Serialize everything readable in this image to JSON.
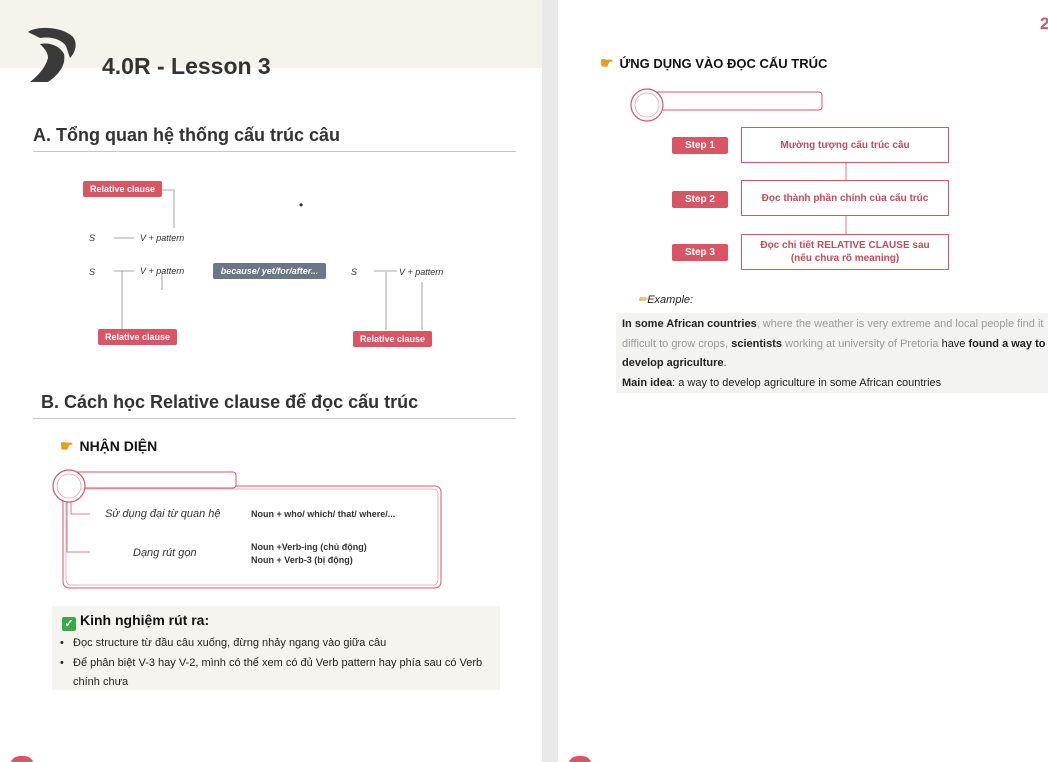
{
  "lesson_title": "4.0R - Lesson 3",
  "section_a": "A. Tổng quan hệ thống cấu trúc câu",
  "section_b": "B. Cách học Relative clause để đọc cấu trúc",
  "diagram": {
    "relative_clause": "Relative clause",
    "s": "S",
    "v_pattern": "V + pattern",
    "connectors": "because/ yet/for/after...",
    "dot": "•"
  },
  "nhan_dien": {
    "heading": "NHẬN DIỆN",
    "row1_label": "Sử dụng đại từ quan hệ",
    "row1_value": "Noun + who/ which/ that/ where/...",
    "row2_label": "Dạng rút gọn",
    "row2_value_1": "Noun +Verb-ing (chủ động)",
    "row2_value_2": "Noun + Verb-3 (bị động)"
  },
  "kinh_nghiem": {
    "title": "Kinh nghiệm rút ra:",
    "bullet_1": "Đọc structure từ đầu câu xuống, đừng nhảy ngang vào giữa câu",
    "bullet_2a": "Để phân biệt V-3 hay V-2, mình có thể xem có đủ Verb pattern hay phía sau có Verb",
    "bullet_2b": "chính chưa"
  },
  "ung_dung": {
    "heading": "ỨNG DỤNG VÀO ĐỌC CẤU TRÚC",
    "steps": [
      {
        "label": "Step 1",
        "text": "Mường tượng cấu trúc câu"
      },
      {
        "label": "Step 2",
        "text": "Đọc thành phần chính của cấu trúc"
      },
      {
        "label": "Step 3",
        "text": "Đọc chi tiết RELATIVE CLAUSE sau",
        "text2": "(nếu chưa rõ meaning)"
      }
    ],
    "example_label": "Example:",
    "ex": {
      "p1_bold": "In some African countries",
      "p1_grey": ", where the weather is very extreme and local people find it",
      "p2_grey": "difficult to grow crops,",
      "p2_bold": " scientists",
      "p2_grey2": " working at university of Pretoria",
      "p2_tail": " have ",
      "p2_bold2": "found a way to",
      "p3_bold": "develop agriculture",
      "p3_tail": ".",
      "main_label": "Main idea",
      "main_text": ": a way to develop agriculture in some African countries"
    }
  },
  "page_number": "2"
}
